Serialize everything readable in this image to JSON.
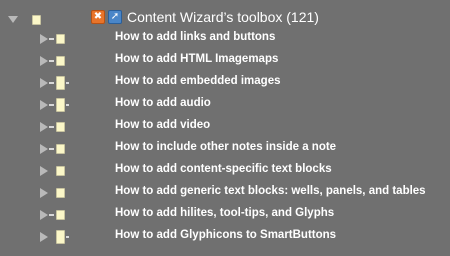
{
  "root": {
    "title": "Content Wizard’s toolbox",
    "count": "(121)",
    "prototype_icon": "prototype-badge-icon",
    "alias_icon": "alias-arrow-icon"
  },
  "children": [
    {
      "label": "How to add links and buttons",
      "has_links": true
    },
    {
      "label": "How to add HTML Imagemaps",
      "has_links": true
    },
    {
      "label": "How to add embedded images",
      "has_links": true
    },
    {
      "label": "How to add audio",
      "has_links": true
    },
    {
      "label": "How to add video",
      "has_links": true
    },
    {
      "label": "How to include other notes inside a note",
      "has_links": true
    },
    {
      "label": "How to add content-specific text blocks",
      "has_links": false
    },
    {
      "label": "How to add generic text blocks: wells, panels, and tables",
      "has_links": false
    },
    {
      "label": "How to add hilites, tool-tips, and Glyphs",
      "has_links": true
    },
    {
      "label": "How to add Glyphicons to SmartButtons",
      "has_links": true
    }
  ],
  "colors": {
    "background": "#707070",
    "text": "#ffffff",
    "note": "#fbf7c8",
    "prototype_badge": "#e8742a",
    "alias_badge": "#4a86c8"
  }
}
